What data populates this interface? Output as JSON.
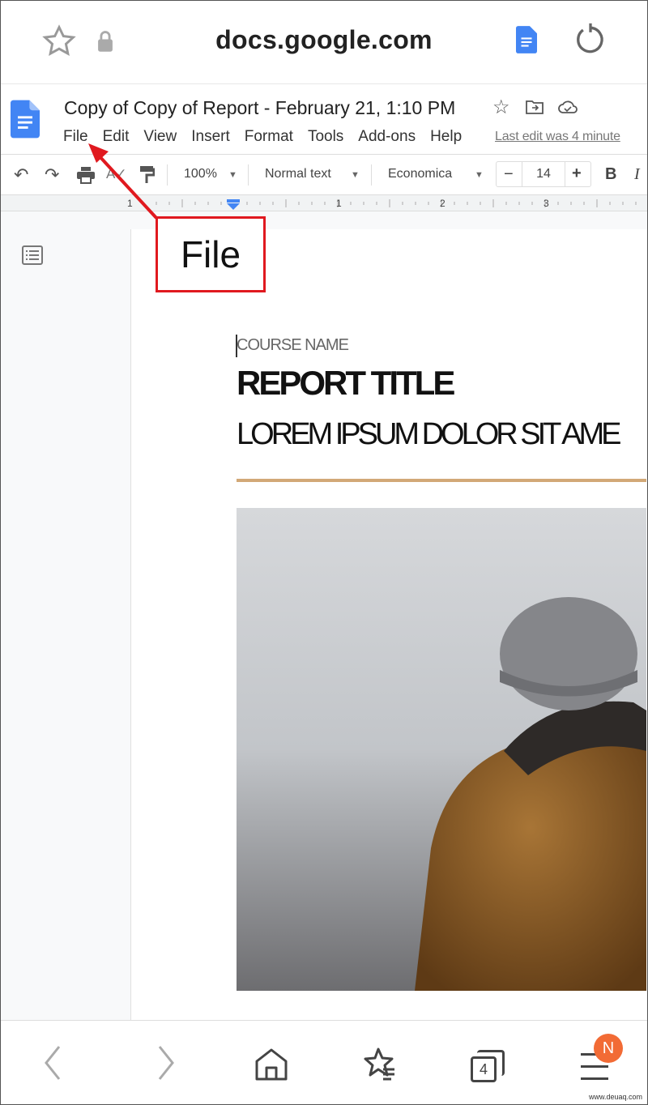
{
  "browser": {
    "url": "docs.google.com",
    "tab_count": "4",
    "menu_badge": "N",
    "badge_color": "#f26b35"
  },
  "doc": {
    "title": "Copy of Copy of Report - February 21, 1:10 PM",
    "menu": [
      "File",
      "Edit",
      "View",
      "Insert",
      "Format",
      "Tools",
      "Add-ons",
      "Help"
    ],
    "last_edit": "Last edit was 4 minute"
  },
  "toolbar": {
    "zoom": "100%",
    "style": "Normal text",
    "font": "Economica",
    "font_size": "14",
    "bold": "B",
    "italic": "I"
  },
  "ruler": {
    "ticks": [
      "1",
      "1",
      "2",
      "3"
    ]
  },
  "annotation": {
    "label": "File",
    "color": "#e0191f"
  },
  "content": {
    "course": "COURSE NAME",
    "report_title": "REPORT TITLE",
    "subtitle": "LOREM IPSUM DOLOR SIT AME",
    "accent": "#d2a877"
  },
  "watermark": "www.deuaq.com"
}
